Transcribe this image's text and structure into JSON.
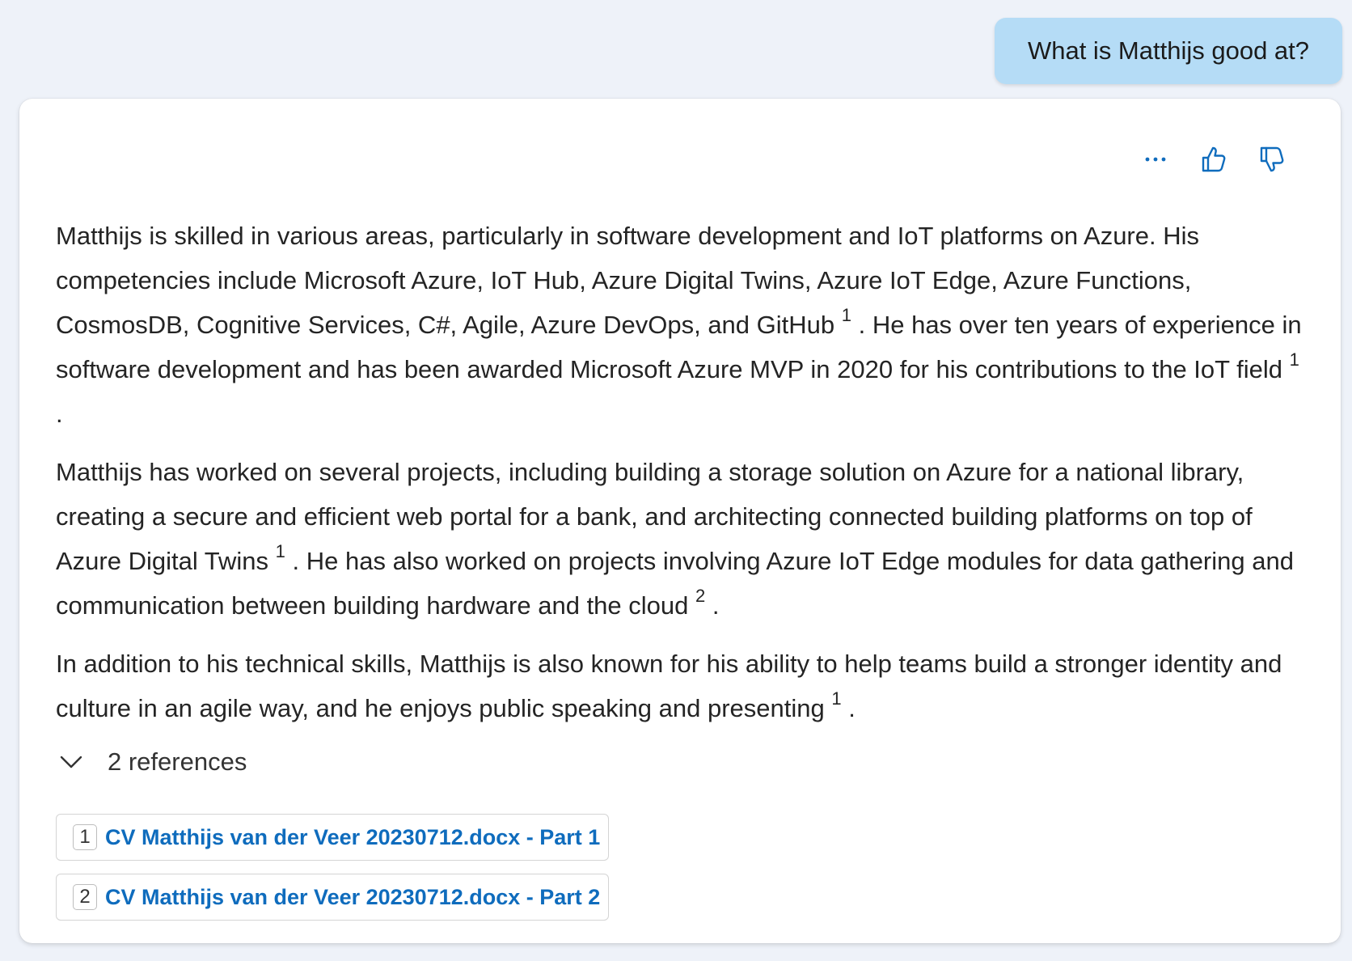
{
  "user_message": "What is Matthijs good at?",
  "actions": {
    "more_icon": "more-horizontal-icon",
    "like_icon": "thumbs-up-icon",
    "dislike_icon": "thumbs-down-icon"
  },
  "response": {
    "p1": {
      "a": "Matthijs is skilled in various areas, particularly in software development and IoT platforms on Azure. His competencies include Microsoft Azure, IoT Hub, Azure Digital Twins, Azure IoT Edge, Azure Functions, CosmosDB, Cognitive Services, C#, Agile, Azure DevOps, and GitHub ",
      "ref1": "1",
      "b": " . He has over ten years of experience in software development and has been awarded Microsoft Azure MVP in 2020 for his contributions to the IoT field ",
      "ref2": "1",
      "c": " ."
    },
    "p2": {
      "a": "Matthijs has worked on several projects, including building a storage solution on Azure for a national library, creating a secure and efficient web portal for a bank, and architecting connected building platforms on top of Azure Digital Twins ",
      "ref1": "1",
      "b": " . He has also worked on projects involving Azure IoT Edge modules for data gathering and communication between building hardware and the cloud ",
      "ref2": "2",
      "c": " ."
    },
    "p3": {
      "a": "In addition to his technical skills, Matthijs is also known for his ability to help teams build a stronger identity and culture in an agile way, and he enjoys public speaking and presenting ",
      "ref1": "1",
      "b": " ."
    }
  },
  "references": {
    "toggle_label": "2 references",
    "toggle_icon": "chevron-down-icon",
    "items": [
      {
        "num": "1",
        "label": "CV Matthijs van der Veer 20230712.docx - Part 1"
      },
      {
        "num": "2",
        "label": "CV Matthijs van der Veer 20230712.docx - Part 2"
      }
    ]
  },
  "colors": {
    "background": "#eef2f9",
    "user_bubble": "#b5dcf6",
    "accent": "#0f6cbd"
  }
}
